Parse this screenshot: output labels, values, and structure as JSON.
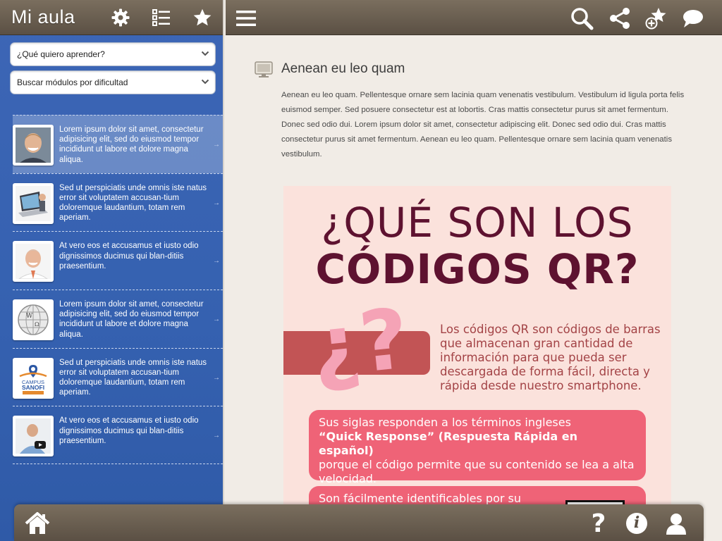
{
  "app": {
    "title": "Mi aula"
  },
  "sidebar": {
    "header_icons": [
      "gear-icon",
      "list-icon",
      "star-icon"
    ],
    "dropdowns": [
      {
        "value": "¿Qué quiero aprender?"
      },
      {
        "value": "Buscar módulos por dificultad"
      }
    ],
    "modules": [
      {
        "text": "Lorem ipsum dolor sit amet, consectetur adipisicing elit, sed do eiusmod tempor incididunt ut labore et dolore magna aliqua.",
        "thumb": "person-portrait",
        "active": true
      },
      {
        "text": "Sed ut perspiciatis unde omnis iste natus error sit voluptatem accusan-tium doloremque laudantium, totam rem aperiam.",
        "thumb": "laptop-image",
        "active": false
      },
      {
        "text": "At vero eos et accusamus et iusto odio dignissimos ducimus qui blan-ditiis praesentium.",
        "thumb": "person-portrait",
        "active": false
      },
      {
        "text": "Lorem ipsum dolor sit amet, consectetur adipisicing elit, sed do eiusmod tempor incididunt ut labore et dolore magna aliqua.",
        "thumb": "wikipedia-globe",
        "active": false
      },
      {
        "text": "Sed ut perspiciatis unde omnis iste natus error sit voluptatem accusan-tium doloremque laudantium, totam rem aperiam.",
        "thumb": "campus-sanofi-logo",
        "active": false
      },
      {
        "text": "At vero eos et accusamus et iusto odio dignissimos ducimus qui blan-ditiis praesentium.",
        "thumb": "video-thumbnail",
        "active": false
      }
    ],
    "campus_logo": {
      "line1": "CAMPUS",
      "line2": "SANOFI"
    }
  },
  "topbar": {
    "icons": [
      "menu-icon",
      "search-icon",
      "share-icon",
      "favorite-add-icon",
      "comment-icon"
    ]
  },
  "article": {
    "title": "Aenean eu leo quam",
    "body": "Aenean eu leo quam. Pellentesque ornare sem lacinia quam venenatis vestibulum. Vestibulum id ligula porta felis euismod semper. Sed posuere consectetur est at lobortis. Cras mattis consectetur purus sit amet fermentum. Donec sed odio dui. Lorem ipsum dolor sit amet, consectetur adipiscing elit. Donec sed odio dui. Cras mattis consectetur purus sit amet fermentum. Aenean eu leo quam. Pellentesque ornare sem lacinia quam venenatis vestibulum."
  },
  "infographic": {
    "title_line1": "¿QUÉ SON LOS",
    "title_line2": "CÓDIGOS QR?",
    "question_mark": "¿?",
    "description": "Los códigos QR son códigos de barras que almacenan gran cantidad de información para que pueda ser descargada de forma fácil, directa y rápida desde nuestro smartphone.",
    "box1_pre": "Sus siglas responden a los términos ingleses",
    "box1_bold": "“Quick Response” (Respuesta Rápida en español)",
    "box1_post": "porque el código permite que su contenido se lea a alta velocidad.",
    "box2": "Son fácilmente identificables por su"
  },
  "bottombar": {
    "icons": [
      "home-icon",
      "help-icon",
      "info-icon",
      "user-icon"
    ],
    "help_glyph": "?",
    "info_glyph": "i"
  },
  "colors": {
    "sidebar_blue": "#3561b0",
    "bar_brown": "#6b5f50",
    "infographic_bg": "#fbe2dc",
    "infographic_title": "#5e1230",
    "infographic_pink": "#ef6377",
    "infographic_red": "#c25455"
  }
}
